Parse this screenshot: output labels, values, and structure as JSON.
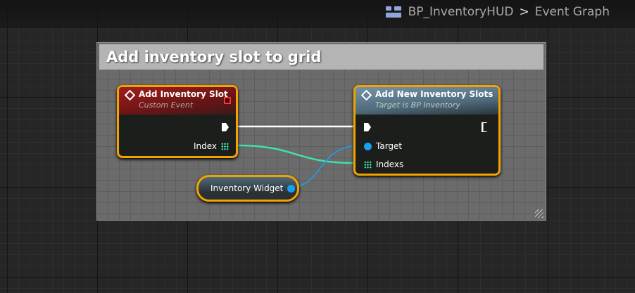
{
  "breadcrumb": {
    "blueprint": "BP_InventoryHUD",
    "separator": ">",
    "graph": "Event Graph"
  },
  "comment": {
    "title": "Add inventory slot to grid"
  },
  "nodes": {
    "event": {
      "title": "Add Inventory Slot",
      "subtitle": "Custom Event",
      "pins": {
        "index": "Index"
      }
    },
    "call": {
      "title": "Add New Inventory Slots",
      "subtitle": "Target is BP Inventory",
      "pins": {
        "target": "Target",
        "indexs": "Indexs"
      }
    },
    "variable": {
      "label": "Inventory Widget"
    }
  },
  "colors": {
    "exec": "#ffffff",
    "int_array": "#3fe0b0",
    "object": "#1aa0f0",
    "selection": "#f2a300",
    "event_header": "#8a1a1a",
    "call_header": "#5a7f97"
  }
}
